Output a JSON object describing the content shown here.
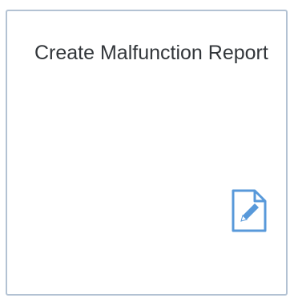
{
  "tile": {
    "title": "Create Malfunction Report",
    "icon": "document-edit-icon",
    "icon_color": "#5899da",
    "border_color": "#b3c2d3",
    "text_color": "#32363a"
  }
}
